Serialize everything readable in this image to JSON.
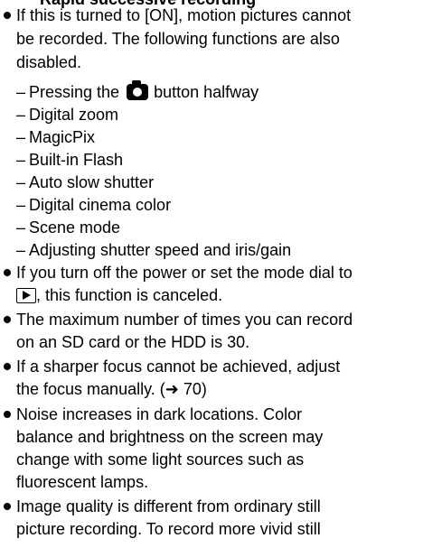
{
  "heading": "Rapid successive recording",
  "bullets": [
    {
      "lines": [
        "If this is turned to [ON], motion pictures cannot",
        "be recorded. The following functions are also",
        "disabled."
      ]
    },
    {
      "lines": [
        "If you turn off the power or set the mode dial to",
        ", this function is canceled."
      ]
    },
    {
      "lines": [
        "The maximum number of times you can record",
        "on an SD card or the HDD is 30."
      ]
    },
    {
      "lines": [
        "If a sharper focus cannot be achieved, adjust",
        "the focus manually. (➜ 70)"
      ]
    },
    {
      "lines": [
        "Noise increases in dark locations. Color",
        "balance and brightness on the screen may",
        "change with some light sources such as",
        "fluorescent lamps."
      ]
    },
    {
      "lines": [
        "Image quality is different from ordinary still",
        "picture recording. To record more vivid still"
      ]
    }
  ],
  "disabled_functions": {
    "dash": "–",
    "first_before": "Pressing the",
    "first_after": "button halfway",
    "items": [
      "Digital zoom",
      "MagicPix",
      "Built-in Flash",
      "Auto slow shutter",
      "Digital cinema color",
      "Scene mode",
      "Adjusting shutter speed and iris/gain"
    ]
  },
  "icons": {
    "photo_shutter": "camera-shutter-icon",
    "playback_mode": "playback-mode-icon",
    "bullet": "bullet-dot-icon"
  }
}
